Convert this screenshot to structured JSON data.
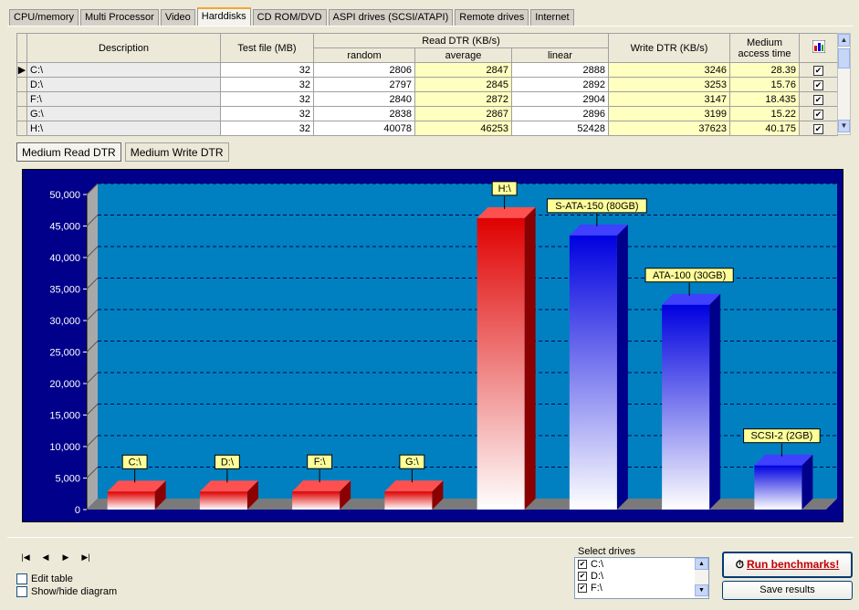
{
  "tabs": [
    "CPU/memory",
    "Multi Processor",
    "Video",
    "Harddisks",
    "CD ROM/DVD",
    "ASPI drives (SCSI/ATAPI)",
    "Remote drives",
    "Internet"
  ],
  "active_tab": 3,
  "table": {
    "headers": {
      "description": "Description",
      "test_file": "Test file (MB)",
      "read_dtr": "Read DTR (KB/s)",
      "random": "random",
      "average": "average",
      "linear": "linear",
      "write_dtr": "Write DTR (KB/s)",
      "access_time": "Medium access time"
    },
    "rows": [
      {
        "desc": "C:\\",
        "test": "32",
        "random": "2806",
        "average": "2847",
        "linear": "2888",
        "write": "3246",
        "access": "28.39",
        "checked": true
      },
      {
        "desc": "D:\\",
        "test": "32",
        "random": "2797",
        "average": "2845",
        "linear": "2892",
        "write": "3253",
        "access": "15.76",
        "checked": true
      },
      {
        "desc": "F:\\",
        "test": "32",
        "random": "2840",
        "average": "2872",
        "linear": "2904",
        "write": "3147",
        "access": "18.435",
        "checked": true
      },
      {
        "desc": "G:\\",
        "test": "32",
        "random": "2838",
        "average": "2867",
        "linear": "2896",
        "write": "3199",
        "access": "15.22",
        "checked": true
      },
      {
        "desc": "H:\\",
        "test": "32",
        "random": "40078",
        "average": "46253",
        "linear": "52428",
        "write": "37623",
        "access": "40.175",
        "checked": true
      }
    ]
  },
  "subtabs": [
    "Medium Read DTR",
    "Medium Write DTR"
  ],
  "active_subtab": 0,
  "chart_data": {
    "type": "bar",
    "categories": [
      "C:\\",
      "D:\\",
      "F:\\",
      "G:\\",
      "H:\\",
      "S-ATA-150 (80GB)",
      "ATA-100 (30GB)",
      "SCSI-2 (2GB)"
    ],
    "values": [
      2847,
      2845,
      2872,
      2867,
      46253,
      43500,
      32500,
      7000
    ],
    "colors": [
      "red",
      "red",
      "red",
      "red",
      "red",
      "blue",
      "blue",
      "blue"
    ],
    "ylim": [
      0,
      50000
    ],
    "yticks": [
      "0",
      "5,000",
      "10,000",
      "15,000",
      "20,000",
      "25,000",
      "30,000",
      "35,000",
      "40,000",
      "45,000",
      "50,000"
    ],
    "grid": true,
    "legend": "none"
  },
  "colors": {
    "red_bar": "#e00000",
    "blue_bar": "#0000e0",
    "plot_bg": "#0080c0",
    "frame": "#00008b",
    "label_bg": "#ffff99"
  },
  "nav": [
    "|◀",
    "◀",
    "▶",
    "▶|"
  ],
  "options": {
    "edit_table": "Edit table",
    "show_hide": "Show/hide diagram"
  },
  "select_drives": {
    "label": "Select drives",
    "items": [
      "C:\\",
      "D:\\",
      "F:\\"
    ]
  },
  "buttons": {
    "run": "Run benchmarks!",
    "save": "Save results"
  }
}
